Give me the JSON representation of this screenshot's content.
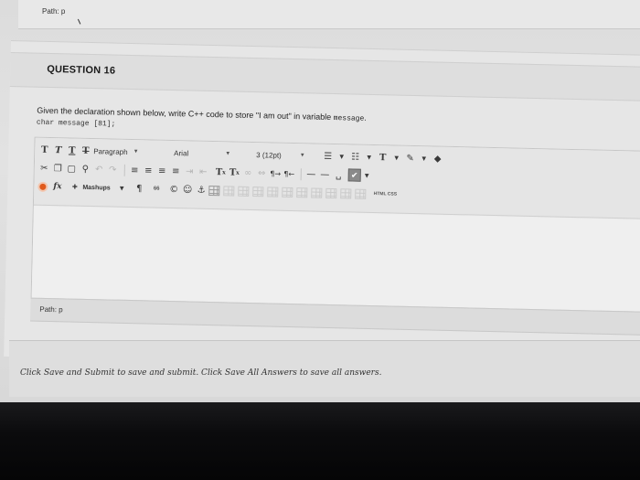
{
  "top_path": {
    "label": "Path: p"
  },
  "question": {
    "title": "QUESTION 16",
    "text_prefix": "Given the declaration shown below, write C++ code to store \"I am out\" in variable ",
    "text_code": "message",
    "text_suffix": ".",
    "code": "char message [81];"
  },
  "toolbar": {
    "row1": {
      "bold": "T",
      "italic": "T",
      "underline": "T",
      "strike": "T",
      "paragraph": "Paragraph",
      "font": "Arial",
      "size": "3 (12pt)",
      "text_color_label": "T"
    },
    "row2": {
      "superscript": "T",
      "subscript": "T"
    },
    "row3": {
      "formula": "fx",
      "mashups": "Mashups",
      "quote": "66",
      "html_css": "HTML CSS"
    }
  },
  "bottom_path": {
    "label": "Path: p"
  },
  "footer": {
    "text": "Click Save and Submit to save and submit. Click Save All Answers to save all answers."
  }
}
